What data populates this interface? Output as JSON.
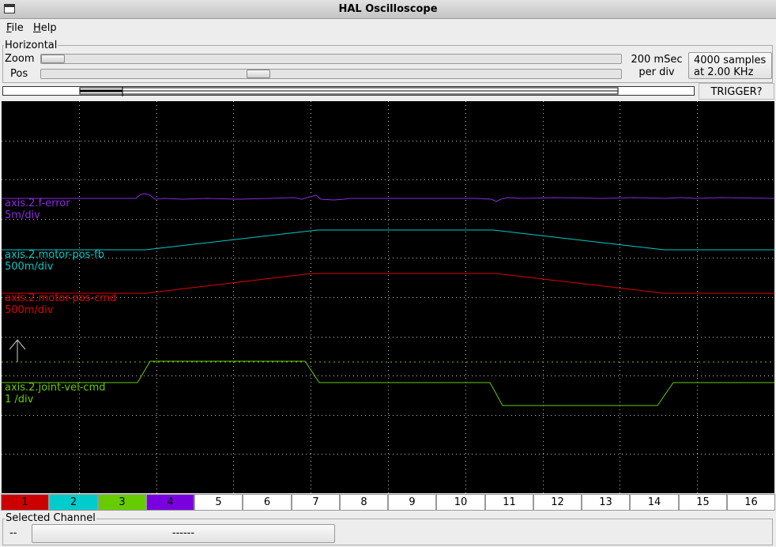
{
  "window": {
    "title": "HAL Oscilloscope"
  },
  "menu": {
    "file": {
      "mnemonic": "F",
      "rest": "ile"
    },
    "help": {
      "mnemonic": "H",
      "rest": "elp"
    }
  },
  "horizontal": {
    "frame_label": "Horizontal",
    "zoom_label": "Zoom",
    "pos_label": "Pos",
    "zoom_value": 0.0,
    "pos_value": 0.37,
    "rate_line1": "200 mSec",
    "rate_line2": "per div",
    "samples_line1": "4000 samples",
    "samples_line2": "at 2.00 KHz"
  },
  "trigger": {
    "label": "TRIGGER?"
  },
  "channels": {
    "fe": {
      "name": "axis.2.f-error",
      "scale": "5m/div",
      "color": "#8a2be2"
    },
    "fb": {
      "name": "axis.2.motor-pos-fb",
      "scale": "500m/div",
      "color": "#00c8c8"
    },
    "cmd": {
      "name": "axis.2.motor-pos-cmd",
      "scale": "500m/div",
      "color": "#e00000"
    },
    "vel": {
      "name": "axis.2.joint-vel-cmd",
      "scale": "1 /div",
      "color": "#66cc00"
    }
  },
  "channel_buttons": [
    {
      "label": "1",
      "color": "#cc0000"
    },
    {
      "label": "2",
      "color": "#00cccc"
    },
    {
      "label": "3",
      "color": "#66cc00"
    },
    {
      "label": "4",
      "color": "#7a00e0"
    },
    {
      "label": "5",
      "color": "#ffffff"
    },
    {
      "label": "6",
      "color": "#ffffff"
    },
    {
      "label": "7",
      "color": "#ffffff"
    },
    {
      "label": "8",
      "color": "#ffffff"
    },
    {
      "label": "9",
      "color": "#ffffff"
    },
    {
      "label": "10",
      "color": "#ffffff"
    },
    {
      "label": "11",
      "color": "#ffffff"
    },
    {
      "label": "12",
      "color": "#ffffff"
    },
    {
      "label": "13",
      "color": "#ffffff"
    },
    {
      "label": "14",
      "color": "#ffffff"
    },
    {
      "label": "15",
      "color": "#ffffff"
    },
    {
      "label": "16",
      "color": "#ffffff"
    }
  ],
  "selected_channel": {
    "frame_label": "Selected Channel",
    "value": "--",
    "button_label": "------"
  }
}
